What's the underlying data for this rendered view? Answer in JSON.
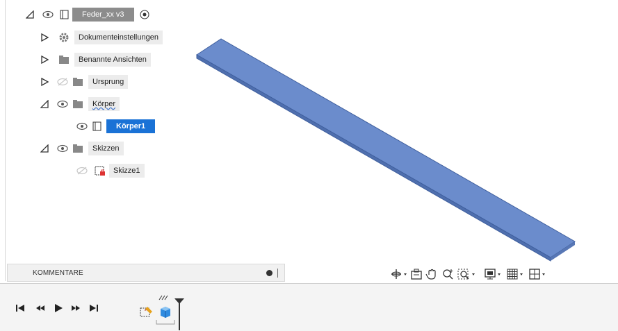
{
  "browser": {
    "root": {
      "label": "Feder_xx v3"
    },
    "items": [
      {
        "label": "Dokumenteinstellungen"
      },
      {
        "label": "Benannte Ansichten"
      },
      {
        "label": "Ursprung"
      },
      {
        "label": "Körper"
      },
      {
        "label": "Körper1"
      },
      {
        "label": "Skizzen"
      },
      {
        "label": "Skizze1"
      }
    ]
  },
  "comments": {
    "label": "KOMMENTARE"
  },
  "colors": {
    "body_fill": "#6b8ccc",
    "body_edge": "#3f5f9e",
    "selection": "#1a72d6"
  },
  "icons": [
    "eye-icon",
    "gear-icon",
    "folder-icon",
    "body-icon",
    "sketch-icon",
    "orbit-icon",
    "look-at-icon",
    "pan-icon",
    "zoom-icon",
    "fit-icon",
    "display-settings-icon",
    "grid-icon",
    "viewports-icon",
    "first-icon",
    "previous-icon",
    "play-icon",
    "next-icon",
    "last-icon"
  ]
}
